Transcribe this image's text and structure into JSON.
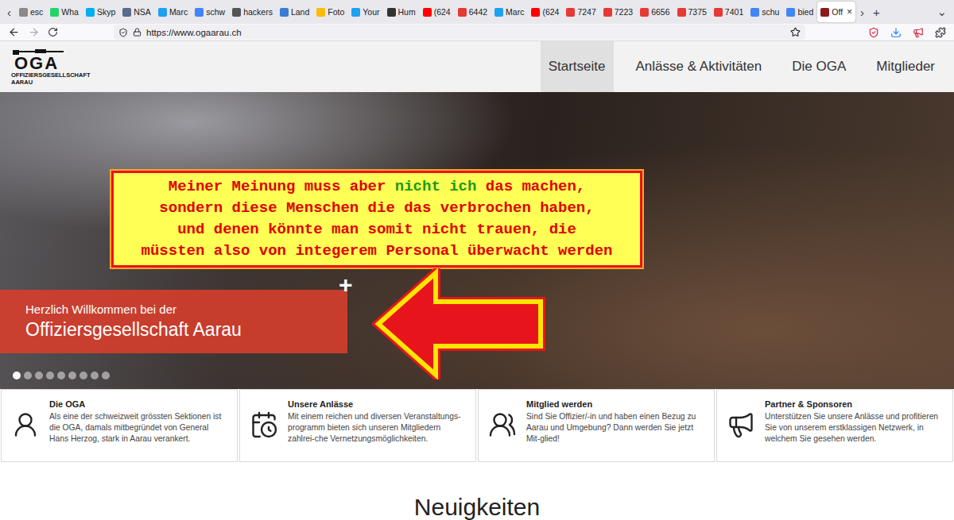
{
  "browser": {
    "scroll_left": "‹",
    "scroll_right": "›",
    "new_tab": "+",
    "tab_list": "⌄",
    "tab_close": "×",
    "address": "https://www.ogaarau.ch",
    "tabs": [
      {
        "label": "esc",
        "selected": false,
        "color": "#8a8a8a"
      },
      {
        "label": "Wha",
        "selected": false,
        "color": "#25d366"
      },
      {
        "label": "Skyp",
        "selected": false,
        "color": "#00aff0"
      },
      {
        "label": "NSA",
        "selected": false,
        "color": "#5a6b8c"
      },
      {
        "label": "Marc",
        "selected": false,
        "color": "#1da1f2"
      },
      {
        "label": "schw",
        "selected": false,
        "color": "#4285f4"
      },
      {
        "label": "hackers",
        "selected": false,
        "color": "#555555"
      },
      {
        "label": "Land",
        "selected": false,
        "color": "#3a7bd5"
      },
      {
        "label": "Foto",
        "selected": false,
        "color": "#fbbc05"
      },
      {
        "label": "Your",
        "selected": false,
        "color": "#1da1f2"
      },
      {
        "label": "Hum",
        "selected": false,
        "color": "#333333"
      },
      {
        "label": "(624",
        "selected": false,
        "color": "#ff0000"
      },
      {
        "label": "6442",
        "selected": false,
        "color": "#e53935"
      },
      {
        "label": "Marc",
        "selected": false,
        "color": "#1da1f2"
      },
      {
        "label": "(624",
        "selected": false,
        "color": "#ff0000"
      },
      {
        "label": "7247",
        "selected": false,
        "color": "#e53935"
      },
      {
        "label": "7223",
        "selected": false,
        "color": "#e53935"
      },
      {
        "label": "6656",
        "selected": false,
        "color": "#e53935"
      },
      {
        "label": "7375",
        "selected": false,
        "color": "#e53935"
      },
      {
        "label": "7401",
        "selected": false,
        "color": "#e53935"
      },
      {
        "label": "schu",
        "selected": false,
        "color": "#4285f4"
      },
      {
        "label": "bied",
        "selected": false,
        "color": "#4285f4"
      },
      {
        "label": "Off",
        "selected": true,
        "color": "#8b1a1a"
      }
    ]
  },
  "site": {
    "logo": {
      "mark": "OGA",
      "name": "OFFIZIERSGESELLSCHAFT",
      "city": "AARAU"
    },
    "nav": [
      {
        "label": "Startseite",
        "selected": true
      },
      {
        "label": "Anlässe & Aktivitäten",
        "selected": false
      },
      {
        "label": "Die OGA",
        "selected": false
      },
      {
        "label": "Mitglieder",
        "selected": false
      }
    ],
    "hero": {
      "plus": "+",
      "welcome_small": "Herzlich Willkommen bei der",
      "welcome_title": "Offiziersgesellschaft Aarau",
      "slides": [
        {
          "selected": true
        },
        {
          "selected": false
        },
        {
          "selected": false
        },
        {
          "selected": false
        },
        {
          "selected": false
        },
        {
          "selected": false
        },
        {
          "selected": false
        },
        {
          "selected": false
        },
        {
          "selected": false
        }
      ]
    },
    "cards": [
      {
        "kind": "soldier",
        "title": "Die OGA",
        "text": "Als eine der schweizweit grössten Sektionen ist die OGA, damals mitbegründet von General Hans Herzog, stark in Aarau verankert."
      },
      {
        "kind": "calendar",
        "title": "Unsere Anlässe",
        "text": "Mit einem reichen und diversen Veranstaltungs-programm bieten sich unseren Mitgliedern zahlrei-che Vernetzungsmöglichkeiten."
      },
      {
        "kind": "members",
        "title": "Mitglied werden",
        "text": "Sind Sie Offizier/-in und haben einen Bezug zu Aarau und Umgebung? Dann werden Sie jetzt Mit-glied!"
      },
      {
        "kind": "megaphone",
        "title": "Partner & Sponsoren",
        "text": "Unterstützen Sie unsere Anlässe und profitieren Sie von unserem erstklassigen Netzwerk, in welchem Sie gesehen werden."
      }
    ],
    "news_heading": "Neuigkeiten"
  },
  "annotation": {
    "lines": [
      [
        {
          "text": "Meiner Meinung muss aber ",
          "highlight": false
        },
        {
          "text": "nicht ich",
          "highlight": true
        },
        {
          "text": " das machen,",
          "highlight": false
        }
      ],
      [
        {
          "text": "sondern diese Menschen die das verbrochen haben,",
          "highlight": false
        }
      ],
      [
        {
          "text": "und denen könnte man somit nicht trauen, die",
          "highlight": false
        }
      ],
      [
        {
          "text": "müssten also von integerem Personal überwacht werden",
          "highlight": false
        }
      ]
    ]
  }
}
